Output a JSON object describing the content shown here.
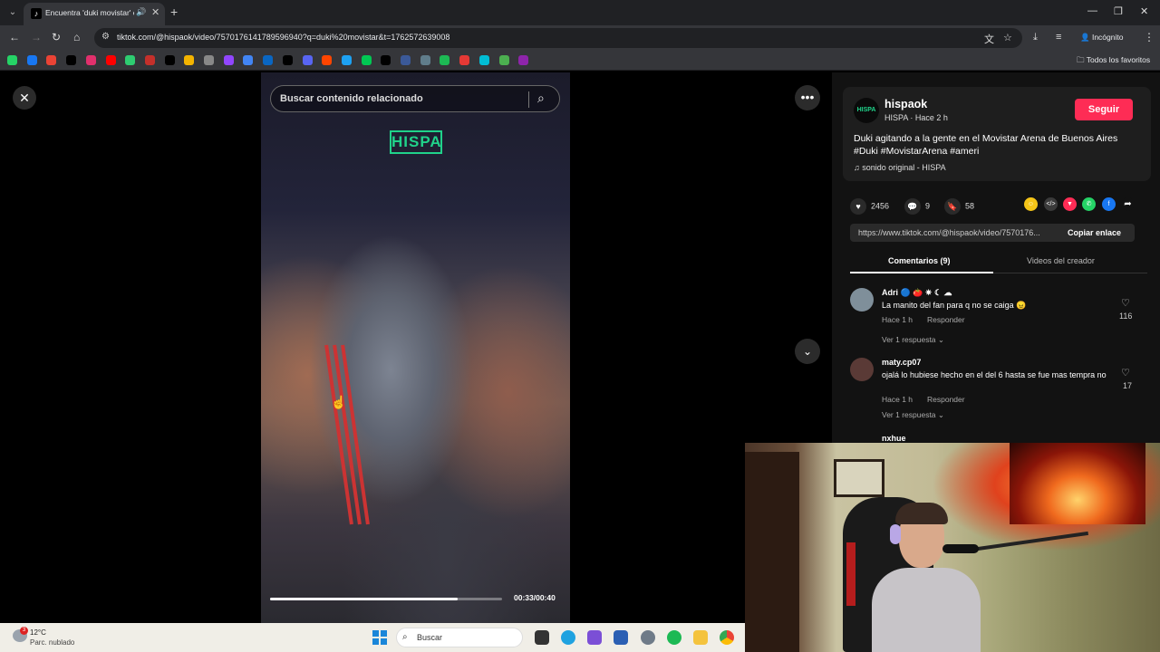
{
  "browser": {
    "tab_title": "Encuentra 'duki movistar' e",
    "url": "tiktok.com/@hispaok/video/7570176141789596940?q=duki%20movistar&t=1762572639008",
    "incognito_label": "Incógnito",
    "bookmarks_folder_label": "Todos los favoritos",
    "bookmark_colors": [
      "#25d366",
      "#1877f2",
      "#ea4335",
      "#000000",
      "#e1306c",
      "#ff0000",
      "#2ecc71",
      "#c4302b",
      "#000000",
      "#f4b400",
      "#888888",
      "#9146ff",
      "#4285f4",
      "#0a66c2",
      "#000000",
      "#5865f2",
      "#ff4500",
      "#1da1f2",
      "#00c853",
      "#000000",
      "#3b5998",
      "#607d8b",
      "#1db954",
      "#e53935",
      "#00bcd4",
      "#4caf50",
      "#8e24aa"
    ]
  },
  "page": {
    "search_placeholder": "Buscar contenido relacionado",
    "video_logo": "HISPA",
    "video_time": "00:33/00:40",
    "progress_fraction": 0.81
  },
  "creator": {
    "username": "hispaok",
    "sub": "HISPA · Hace 2 h",
    "follow_label": "Seguir",
    "avatar_text": "HISPA",
    "description": "Duki agitando a la gente en el Movistar Arena de Buenos Aires #Duki #MovistarArena #ameri",
    "sound": "sonido original - HISPA"
  },
  "stats": {
    "likes": "2456",
    "comments": "9",
    "saves": "58"
  },
  "share": {
    "link": "https://www.tiktok.com/@hispaok/video/7570176...",
    "copy_label": "Copiar enlace",
    "icon_colors": [
      "#f5c518",
      "#3a3a3a",
      "#fe2c55",
      "#25d366",
      "#1877f2",
      "#121212"
    ]
  },
  "tabs": {
    "comments": "Comentarios (9)",
    "creator_videos": "Videos del creador"
  },
  "comments": [
    {
      "user": "Adri",
      "badges": "🔵 🍅 ✷ ☾ ☁",
      "text": "La manito del fan para q no se caiga 😠",
      "time": "Hace 1 h",
      "reply": "Responder",
      "likes": "116",
      "more": "Ver 1 respuesta"
    },
    {
      "user": "maty.cp07",
      "text": "ojalá lo hubiese hecho en el del 6 hasta se fue mas tempra no",
      "time": "Hace 1 h",
      "reply": "Responder",
      "likes": "17",
      "more": "Ver 1 respuesta"
    },
    {
      "user": "nxhue"
    }
  ],
  "taskbar": {
    "weather_badge": "3",
    "temperature": "12°C",
    "weather": "Parc. nublado",
    "search_label": "Buscar"
  }
}
